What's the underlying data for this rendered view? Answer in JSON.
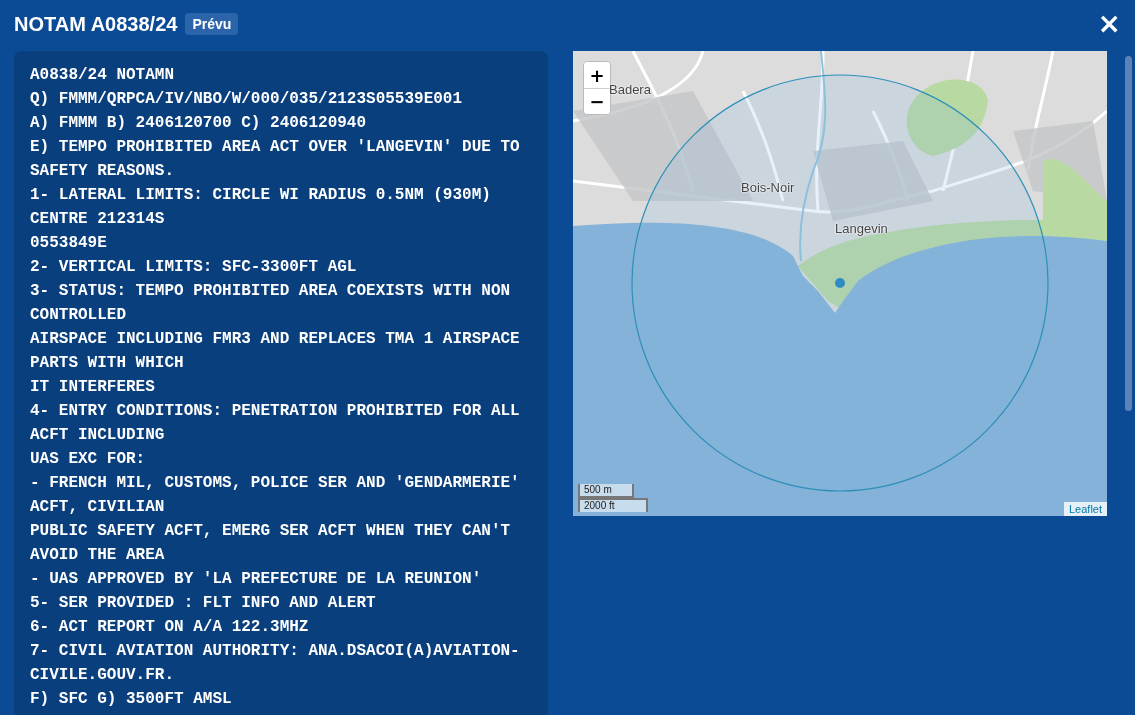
{
  "dialog": {
    "title": "NOTAM A0838/24",
    "status_badge": "Prévu",
    "close": "×"
  },
  "notam_text": {
    "lines": [
      "A0838/24 NOTAMN",
      "Q) FMMM/QRPCA/IV/NBO/W/000/035/2123S05539E001",
      "A) FMMM B) 2406120700 C) 2406120940",
      "E) TEMPO PROHIBITED AREA ACT OVER 'LANGEVIN' DUE TO",
      "SAFETY REASONS.",
      "1- LATERAL LIMITS: CIRCLE WI RADIUS 0.5NM (930M)",
      "CENTRE 212314S",
      "0553849E",
      "2- VERTICAL LIMITS: SFC-3300FT AGL",
      "3- STATUS: TEMPO PROHIBITED AREA COEXISTS WITH NON",
      "CONTROLLED",
      "AIRSPACE INCLUDING FMR3 AND REPLACES TMA 1 AIRSPACE",
      "PARTS WITH WHICH",
      "IT INTERFERES",
      "4- ENTRY CONDITIONS: PENETRATION PROHIBITED FOR ALL",
      "ACFT INCLUDING",
      "UAS EXC FOR:",
      "- FRENCH MIL, CUSTOMS, POLICE SER AND 'GENDARMERIE'",
      "ACFT, CIVILIAN",
      "PUBLIC SAFETY ACFT, EMERG SER ACFT WHEN THEY CAN'T",
      "AVOID THE AREA",
      "- UAS APPROVED BY 'LA PREFECTURE DE LA REUNION'",
      "5- SER PROVIDED : FLT INFO AND ALERT",
      "6- ACT REPORT ON A/A 122.3MHZ",
      "7- CIVIL AVIATION AUTHORITY: ANA.DSACOI(A)AVIATION-",
      "CIVILE.GOUV.FR.",
      "F) SFC G) 3500FT AMSL"
    ]
  },
  "map": {
    "zoom_in": "+",
    "zoom_out": "−",
    "place_labels": [
      "Badera",
      "Bois-Noir",
      "Langevin"
    ],
    "scale": [
      "500 m",
      "2000 ft"
    ],
    "attribution": "Leaflet"
  }
}
